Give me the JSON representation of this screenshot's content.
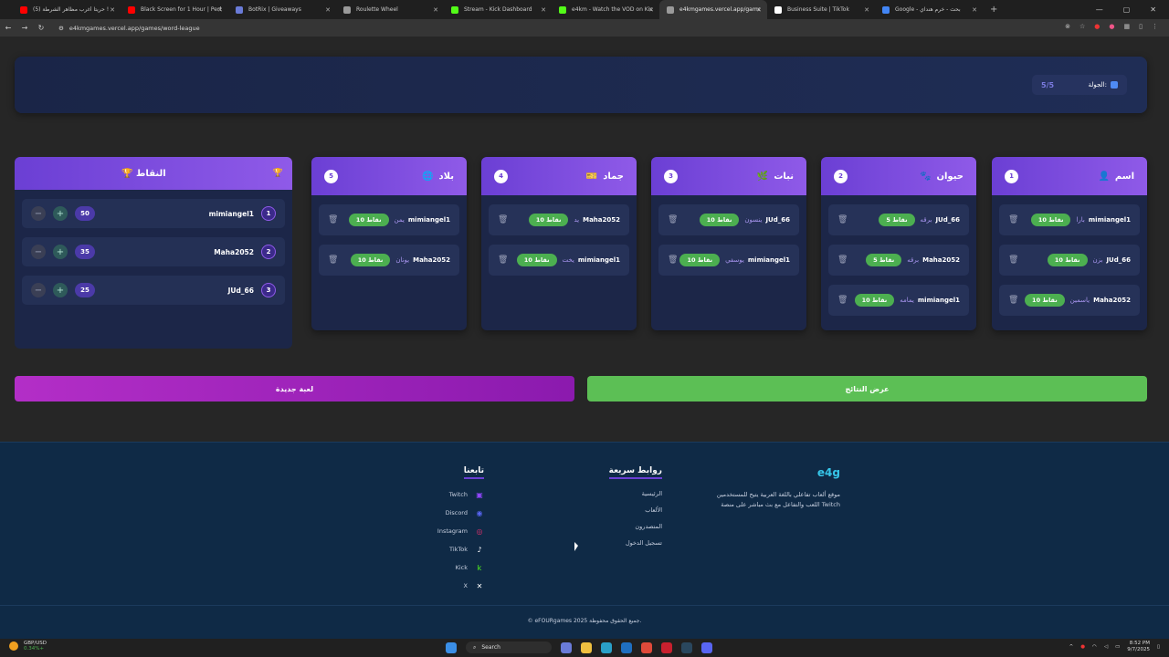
{
  "browser": {
    "tabs": [
      {
        "title": "(5) حريتا أغرب مظاهر الشرطة !",
        "color": "#ff0000"
      },
      {
        "title": "Black Screen for 1 Hour | Perfe",
        "color": "#ff0000"
      },
      {
        "title": "BotRix | Giveaways",
        "color": "#6a7bd8"
      },
      {
        "title": "Roulette Wheel",
        "color": "#9a9a9a"
      },
      {
        "title": "Stream - Kick Dashboard",
        "color": "#53fc18"
      },
      {
        "title": "e4km - Watch the VOD on Kick",
        "color": "#53fc18"
      },
      {
        "title": "e4kmgames.vercel.app/games/",
        "color": "#9a9a9a"
      },
      {
        "title": "Business Suite | TikTok",
        "color": "#ffffff"
      },
      {
        "title": "Google - بحث - خرم هنداي",
        "color": "#4285f4"
      }
    ],
    "active_tab": 6,
    "url": "e4kmgames.vercel.app/games/word-league"
  },
  "round": {
    "label": "الجولة:",
    "value": "5/5"
  },
  "categories": [
    {
      "name": "اسم",
      "num": "1",
      "icon": "👤",
      "entries": [
        {
          "player": "mimiangel1",
          "word": "بارا",
          "points": "10 نقاط"
        },
        {
          "player": "JUd_66",
          "word": "بزن",
          "points": "10 نقاط"
        },
        {
          "player": "Maha2052",
          "word": "ياسمين",
          "points": "10 نقاط"
        }
      ]
    },
    {
      "name": "حيوان",
      "num": "2",
      "icon": "🐾",
      "entries": [
        {
          "player": "JUd_66",
          "word": "برقه",
          "points": "5 نقاط"
        },
        {
          "player": "Maha2052",
          "word": "برقه",
          "points": "5 نقاط"
        },
        {
          "player": "mimiangel1",
          "word": "يمامه",
          "points": "10 نقاط"
        }
      ]
    },
    {
      "name": "نبات",
      "num": "3",
      "icon": "🌿",
      "entries": [
        {
          "player": "JUd_66",
          "word": "ينسون",
          "points": "10 نقاط"
        },
        {
          "player": "mimiangel1",
          "word": "يوسفي",
          "points": "10 نقاط"
        }
      ]
    },
    {
      "name": "جماد",
      "num": "4",
      "icon": "🎫",
      "entries": [
        {
          "player": "Maha2052",
          "word": "يد",
          "points": "10 نقاط"
        },
        {
          "player": "mimiangel1",
          "word": "يخت",
          "points": "10 نقاط"
        }
      ]
    },
    {
      "name": "بلاد",
      "num": "5",
      "icon": "🌐",
      "entries": [
        {
          "player": "mimiangel1",
          "word": "يمن",
          "points": "10 نقاط"
        },
        {
          "player": "Maha2052",
          "word": "يونان",
          "points": "10 نقاط"
        }
      ]
    }
  ],
  "scores": {
    "title": "النقاط",
    "rows": [
      {
        "rank": "1",
        "player": "mimiangel1",
        "score": "50"
      },
      {
        "rank": "2",
        "player": "Maha2052",
        "score": "35"
      },
      {
        "rank": "3",
        "player": "JUd_66",
        "score": "25"
      }
    ]
  },
  "buttons": {
    "new_game": "لعبة جديدة",
    "show_results": "عرض النتائج"
  },
  "footer": {
    "brand": "e4g",
    "about": "موقع ألعاب تفاعلي باللغة العربية يتيح للمستخدمين اللعب والتفاعل مع بث مباشر على منصة Twitch",
    "quick_links_title": "روابط سريعة",
    "quick_links": [
      "الرئيسية",
      "الألعاب",
      "المتصدرون",
      "تسجيل الدخول"
    ],
    "follow_title": "تابعنا",
    "follow": [
      {
        "name": "Twitch",
        "color": "#9146ff",
        "glyph": "▣"
      },
      {
        "name": "Discord",
        "color": "#5865f2",
        "glyph": "◉"
      },
      {
        "name": "Instagram",
        "color": "#e1306c",
        "glyph": "◎"
      },
      {
        "name": "TikTok",
        "color": "#ffffff",
        "glyph": "♪"
      },
      {
        "name": "Kick",
        "color": "#53fc18",
        "glyph": "k"
      },
      {
        "name": "X",
        "color": "#ffffff",
        "glyph": "✕"
      }
    ],
    "copyright": "© eFOURgames 2025 جميع الحقوق محفوظة."
  },
  "taskbar": {
    "ticker": "GBP/USD",
    "ticker_change": "0.34%+",
    "search": "Search",
    "time": "8:52 PM",
    "date": "9/7/2025"
  }
}
